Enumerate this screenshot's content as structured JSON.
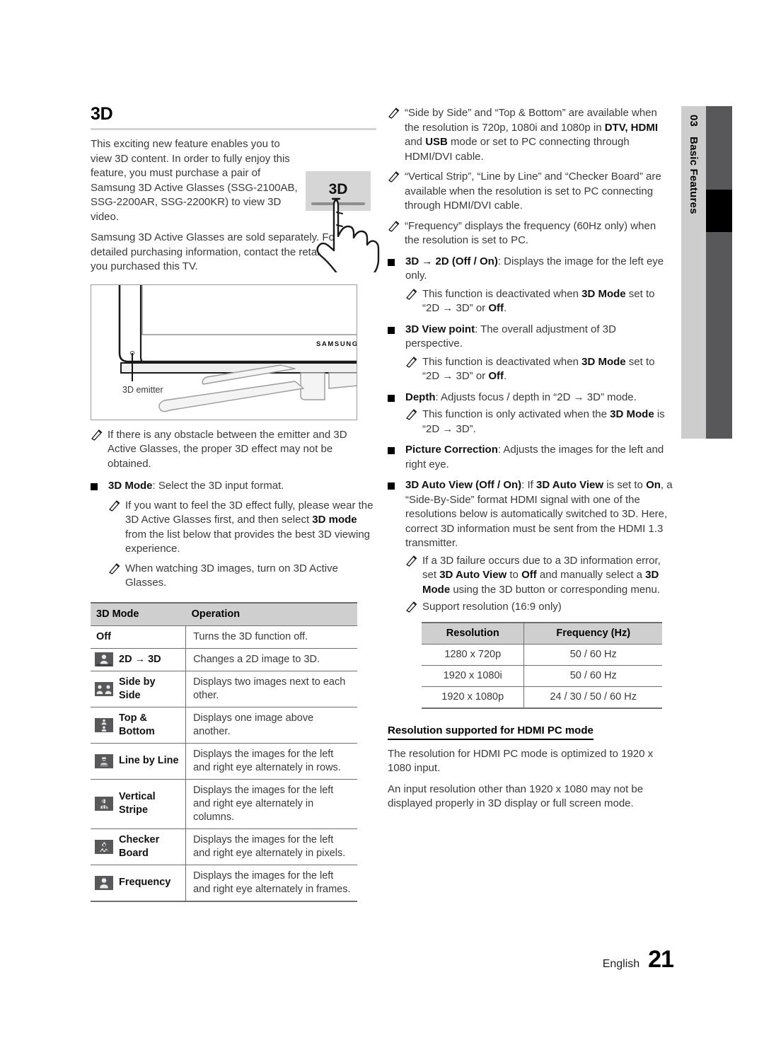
{
  "side_tab": {
    "chapter_number": "03",
    "chapter_title": "Basic Features"
  },
  "footer": {
    "language": "English",
    "page_number": "21"
  },
  "left_column": {
    "section_title": "3D",
    "intro_paragraph_1": "This exciting new feature enables you to view 3D content. In order to fully enjoy this feature, you must purchase a pair of Samsung 3D Active Glasses (SSG-2100AB, SSG-2200AR, SSG-2200KR) to view 3D video.",
    "intro_paragraph_2": "Samsung 3D Active Glasses are sold separately. For more detailed purchasing information, contact the retailer where you purchased this TV.",
    "button_art_label": "3D",
    "tv_figure": {
      "brand_label": "SAMSUNG",
      "callout_label": "3D emitter"
    },
    "note_obstacle": "If there is any obstacle between the emitter and 3D Active Glasses, the proper 3D effect may not be obtained.",
    "bullet_3d_mode": {
      "term": "3D Mode",
      "description": ": Select the 3D input format."
    },
    "note_wear_glasses_1": "If you want to feel the 3D effect fully, please wear the 3D Active Glasses first, and then select ",
    "note_wear_glasses_bold": "3D mode",
    "note_wear_glasses_2": " from the list below that provides the best 3D viewing experience.",
    "note_turn_on": "When watching 3D images, turn on 3D Active Glasses.",
    "mode_table": {
      "headers": [
        "3D Mode",
        "Operation"
      ],
      "rows": [
        {
          "icon": "none",
          "name": "Off",
          "operation": "Turns the 3D function off."
        },
        {
          "icon": "2d-to-3d-icon",
          "name": "2D → 3D",
          "operation": "Changes a 2D image to 3D."
        },
        {
          "icon": "side-by-side-icon",
          "name": "Side by Side",
          "operation": "Displays two images next to each other."
        },
        {
          "icon": "top-bottom-icon",
          "name": "Top & Bottom",
          "operation": "Displays one image above another."
        },
        {
          "icon": "line-by-line-icon",
          "name": "Line by Line",
          "operation": "Displays the images for the left and right eye alternately in rows."
        },
        {
          "icon": "vertical-stripe-icon",
          "name": "Vertical Stripe",
          "operation": "Displays the images for the left and right eye alternately in columns."
        },
        {
          "icon": "checker-board-icon",
          "name": "Checker Board",
          "operation": "Displays the images for the left and right eye alternately in pixels."
        },
        {
          "icon": "frequency-icon",
          "name": "Frequency",
          "operation": "Displays the images for the left and right eye alternately in frames."
        }
      ]
    }
  },
  "right_column": {
    "note_side_by_side_1": "“Side by Side” and “Top & Bottom” are available when the resolution is 720p, 1080i and 1080p in ",
    "note_side_by_side_b1": "DTV, HDMI",
    "note_side_by_side_2": " and ",
    "note_side_by_side_b2": "USB",
    "note_side_by_side_3": " mode or set to PC connecting through HDMI/DVI cable.",
    "note_vertical_strip": "“Vertical Strip”, “Line by Line” and “Checker Board” are available when the resolution is set to PC connecting through HDMI/DVI cable.",
    "note_frequency": "“Frequency” displays the frequency (60Hz only) when the resolution is set to PC.",
    "bullet_3d_to_2d": {
      "term": "3D → 2D (Off / On)",
      "description": ": Displays the image for the left eye only."
    },
    "note_deactivated_1a": "This function is deactivated when ",
    "note_deactivated_1b": "3D Mode",
    "note_deactivated_1c": " set to “2D → 3D” or ",
    "note_deactivated_1d": "Off",
    "note_deactivated_1e": ".",
    "bullet_view_point": {
      "term": "3D View point",
      "description": ": The overall adjustment of 3D perspective."
    },
    "bullet_depth": {
      "term": "Depth",
      "description": ": Adjusts focus / depth in “2D → 3D” mode."
    },
    "note_only_activated_1a": "This function is only activated when the ",
    "note_only_activated_1b": "3D Mode",
    "note_only_activated_1c": " is “2D → 3D”.",
    "bullet_picture_correction": {
      "term": "Picture Correction",
      "description": ": Adjusts the images for the left and right eye."
    },
    "bullet_auto_view": {
      "term": "3D Auto View (Off / On)",
      "d1": ": If ",
      "b1": "3D Auto View",
      "d2": " is set to ",
      "b2": "On",
      "d3": ", a “Side-By-Side” format HDMI signal with one of the resolutions below is automatically switched to 3D. Here, correct 3D information must be sent from the HDMI 1.3 transmitter."
    },
    "note_failure_1": "If a 3D failure occurs due to a 3D information error, set ",
    "note_failure_b1": "3D Auto View",
    "note_failure_2": " to ",
    "note_failure_b2": "Off",
    "note_failure_3": " and manually select a ",
    "note_failure_b3": "3D Mode",
    "note_failure_4": " using the 3D button or corresponding menu.",
    "note_support_resolution": "Support resolution (16:9 only)",
    "resolution_table": {
      "headers": [
        "Resolution",
        "Frequency (Hz)"
      ],
      "rows": [
        {
          "resolution": "1280 x 720p",
          "frequency": "50 / 60 Hz"
        },
        {
          "resolution": "1920 x 1080i",
          "frequency": "50 / 60 Hz"
        },
        {
          "resolution": "1920 x 1080p",
          "frequency": "24 / 30 / 50 / 60 Hz"
        }
      ]
    },
    "hdmi_pc_heading": "Resolution supported for HDMI PC mode",
    "hdmi_pc_paragraph_1": "The resolution for HDMI PC mode is optimized to 1920 x 1080 input.",
    "hdmi_pc_paragraph_2": "An input resolution other than 1920 x 1080 may not be displayed properly in 3D display or full screen mode."
  }
}
